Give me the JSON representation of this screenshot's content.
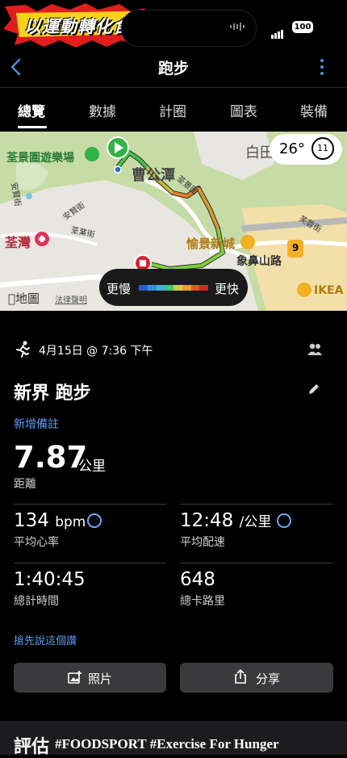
{
  "status_bar": {
    "banner_text": "以運動轉化食糧！",
    "battery": "100"
  },
  "header": {
    "title": "跑步"
  },
  "tabs": [
    {
      "label": "總覽",
      "active": true
    },
    {
      "label": "數據",
      "active": false
    },
    {
      "label": "計圈",
      "active": false
    },
    {
      "label": "圖表",
      "active": false
    },
    {
      "label": "裝備",
      "active": false
    }
  ],
  "map": {
    "weather_temp": "26°",
    "weather_wind": "11",
    "labels": {
      "park": "荃景圍遊樂場",
      "area": "曹公潭",
      "road1": "荃景圍",
      "district": "荃灣",
      "estate": "愉景新城",
      "road2": "象鼻山路",
      "store": "IKEA",
      "route_no": "9",
      "top": "白田",
      "lane": "芙蓉街",
      "street1": "安賢街",
      "street2": "荃業街",
      "street3": "安賢街",
      "maps_brand": "地圖",
      "legal": "法律聲明"
    },
    "legend": {
      "slow": "更慢",
      "fast": "更快",
      "colors": [
        "#2a5fd0",
        "#3b8de0",
        "#3fb2d6",
        "#46c47a",
        "#c8d33a",
        "#f0a02a",
        "#e8532a",
        "#d8262a"
      ]
    }
  },
  "activity": {
    "date": "4月15日 @ 7:36 下午",
    "name": "新界 跑步",
    "add_note": "新增備註",
    "distance": "7.87",
    "distance_unit": "公里",
    "distance_label": "距離"
  },
  "stats": {
    "hr_value": "134",
    "hr_unit": "bpm",
    "hr_label": "平均心率",
    "pace_value": "12:48",
    "pace_unit": "/公里",
    "pace_label": "平均配速",
    "time_value": "1:40:45",
    "time_label": "總計時間",
    "cal_value": "648",
    "cal_label": "總卡路里"
  },
  "first_say": "搶先說這個讚",
  "buttons": {
    "photo": "照片",
    "share": "分享"
  },
  "footer": {
    "eval": "評估",
    "tagline": "#FOODSPORT #Exercise For Hunger"
  }
}
